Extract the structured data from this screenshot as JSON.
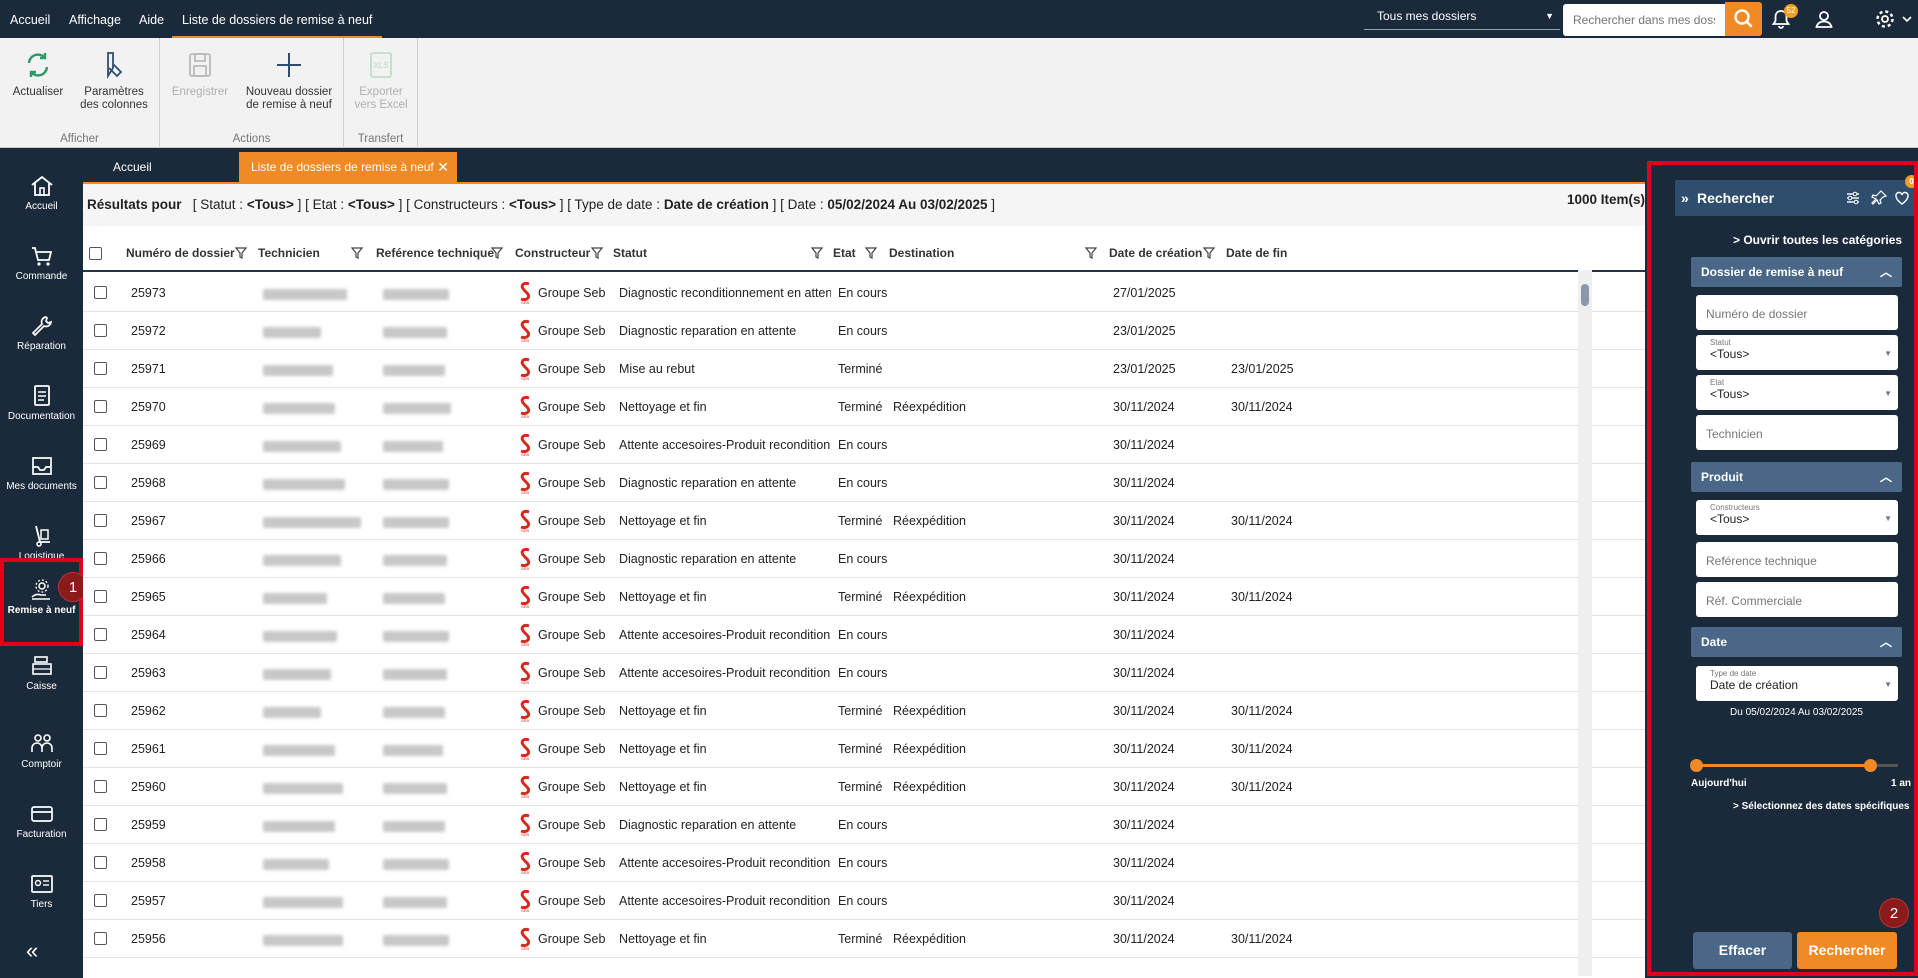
{
  "topbar": {
    "menu": [
      "Accueil",
      "Affichage",
      "Aide",
      "Liste de dossiers de remise à neuf"
    ],
    "folder_select": "Tous mes dossiers",
    "search_placeholder": "Rechercher dans mes dossie",
    "notif_count": "52"
  },
  "ribbon": {
    "refresh": "Actualiser",
    "columns": "Paramètres des colonnes",
    "group_show": "Afficher",
    "save": "Enregistrer",
    "new_folder": "Nouveau dossier de remise à neuf",
    "group_actions": "Actions",
    "xls_label": "XLS",
    "export": "Exporter vers Excel",
    "group_transfer": "Transfert"
  },
  "nav": [
    {
      "label": "Accueil",
      "icon": "home-icon"
    },
    {
      "label": "Commande",
      "icon": "cart-icon"
    },
    {
      "label": "Réparation",
      "icon": "wrench-icon"
    },
    {
      "label": "Documentation",
      "icon": "document-icon"
    },
    {
      "label": "Mes documents",
      "icon": "inbox-icon"
    },
    {
      "label": "Logistique",
      "icon": "dolly-icon"
    },
    {
      "label": "Remise à neuf",
      "icon": "refurbish-icon"
    },
    {
      "label": "Caisse",
      "icon": "register-icon"
    },
    {
      "label": "Comptoir",
      "icon": "people-icon"
    },
    {
      "label": "Facturation",
      "icon": "card-icon"
    },
    {
      "label": "Tiers",
      "icon": "id-card-icon"
    }
  ],
  "badges": {
    "one": "1",
    "two": "2"
  },
  "tabs": {
    "home": "Accueil",
    "active": "Liste de dossiers de remise à neuf"
  },
  "summary": {
    "intro": "Résultats pour",
    "statut_label": "[ Statut : ",
    "statut_value": "<Tous>",
    "etat_label": "]  [ Etat : ",
    "etat_value": "<Tous>",
    "constr_label": "]  [ Constructeurs : ",
    "constr_value": "<Tous>",
    "type_label": "]  [ Type de date : ",
    "type_value": "Date de création",
    "date_label": "]  [ Date : ",
    "date_value": "05/02/2024 Au 03/02/2025",
    "close": " ]",
    "count": "1000 Item(s)"
  },
  "columns": [
    "Numéro de dossier",
    "Technicien",
    "Reférence technique",
    "Constructeur",
    "Statut",
    "Etat",
    "Destination",
    "Date de création",
    "Date de fin"
  ],
  "rows": [
    {
      "num": "25973",
      "constr": "Groupe Seb",
      "statut": "Diagnostic reconditionnement en attente",
      "etat": "En cours",
      "dest": "",
      "created": "27/01/2025",
      "end": ""
    },
    {
      "num": "25972",
      "constr": "Groupe Seb",
      "statut": "Diagnostic reparation en attente",
      "etat": "En cours",
      "dest": "",
      "created": "23/01/2025",
      "end": ""
    },
    {
      "num": "25971",
      "constr": "Groupe Seb",
      "statut": "Mise au rebut",
      "etat": "Terminé",
      "dest": "",
      "created": "23/01/2025",
      "end": "23/01/2025"
    },
    {
      "num": "25970",
      "constr": "Groupe Seb",
      "statut": "Nettoyage et fin",
      "etat": "Terminé",
      "dest": "Réexpédition",
      "created": "30/11/2024",
      "end": "30/11/2024"
    },
    {
      "num": "25969",
      "constr": "Groupe Seb",
      "statut": "Attente accesoires-Produit reconditionné",
      "etat": "En cours",
      "dest": "",
      "created": "30/11/2024",
      "end": ""
    },
    {
      "num": "25968",
      "constr": "Groupe Seb",
      "statut": "Diagnostic reparation en attente",
      "etat": "En cours",
      "dest": "",
      "created": "30/11/2024",
      "end": ""
    },
    {
      "num": "25967",
      "constr": "Groupe Seb",
      "statut": "Nettoyage et fin",
      "etat": "Terminé",
      "dest": "Réexpédition",
      "created": "30/11/2024",
      "end": "30/11/2024"
    },
    {
      "num": "25966",
      "constr": "Groupe Seb",
      "statut": "Diagnostic reparation en attente",
      "etat": "En cours",
      "dest": "",
      "created": "30/11/2024",
      "end": ""
    },
    {
      "num": "25965",
      "constr": "Groupe Seb",
      "statut": "Nettoyage et fin",
      "etat": "Terminé",
      "dest": "Réexpédition",
      "created": "30/11/2024",
      "end": "30/11/2024"
    },
    {
      "num": "25964",
      "constr": "Groupe Seb",
      "statut": "Attente accesoires-Produit reconditionné",
      "etat": "En cours",
      "dest": "",
      "created": "30/11/2024",
      "end": ""
    },
    {
      "num": "25963",
      "constr": "Groupe Seb",
      "statut": "Attente accesoires-Produit reconditionné",
      "etat": "En cours",
      "dest": "",
      "created": "30/11/2024",
      "end": ""
    },
    {
      "num": "25962",
      "constr": "Groupe Seb",
      "statut": "Nettoyage et fin",
      "etat": "Terminé",
      "dest": "Réexpédition",
      "created": "30/11/2024",
      "end": "30/11/2024"
    },
    {
      "num": "25961",
      "constr": "Groupe Seb",
      "statut": "Nettoyage et fin",
      "etat": "Terminé",
      "dest": "Réexpédition",
      "created": "30/11/2024",
      "end": "30/11/2024"
    },
    {
      "num": "25960",
      "constr": "Groupe Seb",
      "statut": "Nettoyage et fin",
      "etat": "Terminé",
      "dest": "Réexpédition",
      "created": "30/11/2024",
      "end": "30/11/2024"
    },
    {
      "num": "25959",
      "constr": "Groupe Seb",
      "statut": "Diagnostic reparation en attente",
      "etat": "En cours",
      "dest": "",
      "created": "30/11/2024",
      "end": ""
    },
    {
      "num": "25958",
      "constr": "Groupe Seb",
      "statut": "Attente accesoires-Produit reconditionné",
      "etat": "En cours",
      "dest": "",
      "created": "30/11/2024",
      "end": ""
    },
    {
      "num": "25957",
      "constr": "Groupe Seb",
      "statut": "Attente accesoires-Produit reconditionné",
      "etat": "En cours",
      "dest": "",
      "created": "30/11/2024",
      "end": ""
    },
    {
      "num": "25956",
      "constr": "Groupe Seb",
      "statut": "Nettoyage et fin",
      "etat": "Terminé",
      "dest": "Réexpédition",
      "created": "30/11/2024",
      "end": "30/11/2024"
    }
  ],
  "panel": {
    "title": "Rechercher",
    "fav_count": "0",
    "open_all": "Ouvrir toutes les catégories",
    "sect_folder": "Dossier de remise à neuf",
    "num_placeholder": "Numéro de dossier",
    "statut_label": "Statut",
    "statut_value": "<Tous>",
    "etat_label": "Etat",
    "etat_value": "<Tous>",
    "tech_placeholder": "Technicien",
    "sect_product": "Produit",
    "constr_label": "Constructeurs",
    "constr_value": "<Tous>",
    "ref_tech_placeholder": "Reférence technique",
    "ref_com_placeholder": "Réf. Commerciale",
    "sect_date": "Date",
    "type_label": "Type de date",
    "type_value": "Date de création",
    "range": "Du 05/02/2024 Au 03/02/2025",
    "slider_min": "Aujourd'hui",
    "slider_max": "1 an",
    "specific": "Sélectionnez des dates spécifiques",
    "clear": "Effacer",
    "search": "Rechercher"
  },
  "colors": {
    "accent": "#f08a24",
    "dark": "#1b2a3a",
    "section": "#4a6787",
    "highlight": "#e0001a"
  }
}
